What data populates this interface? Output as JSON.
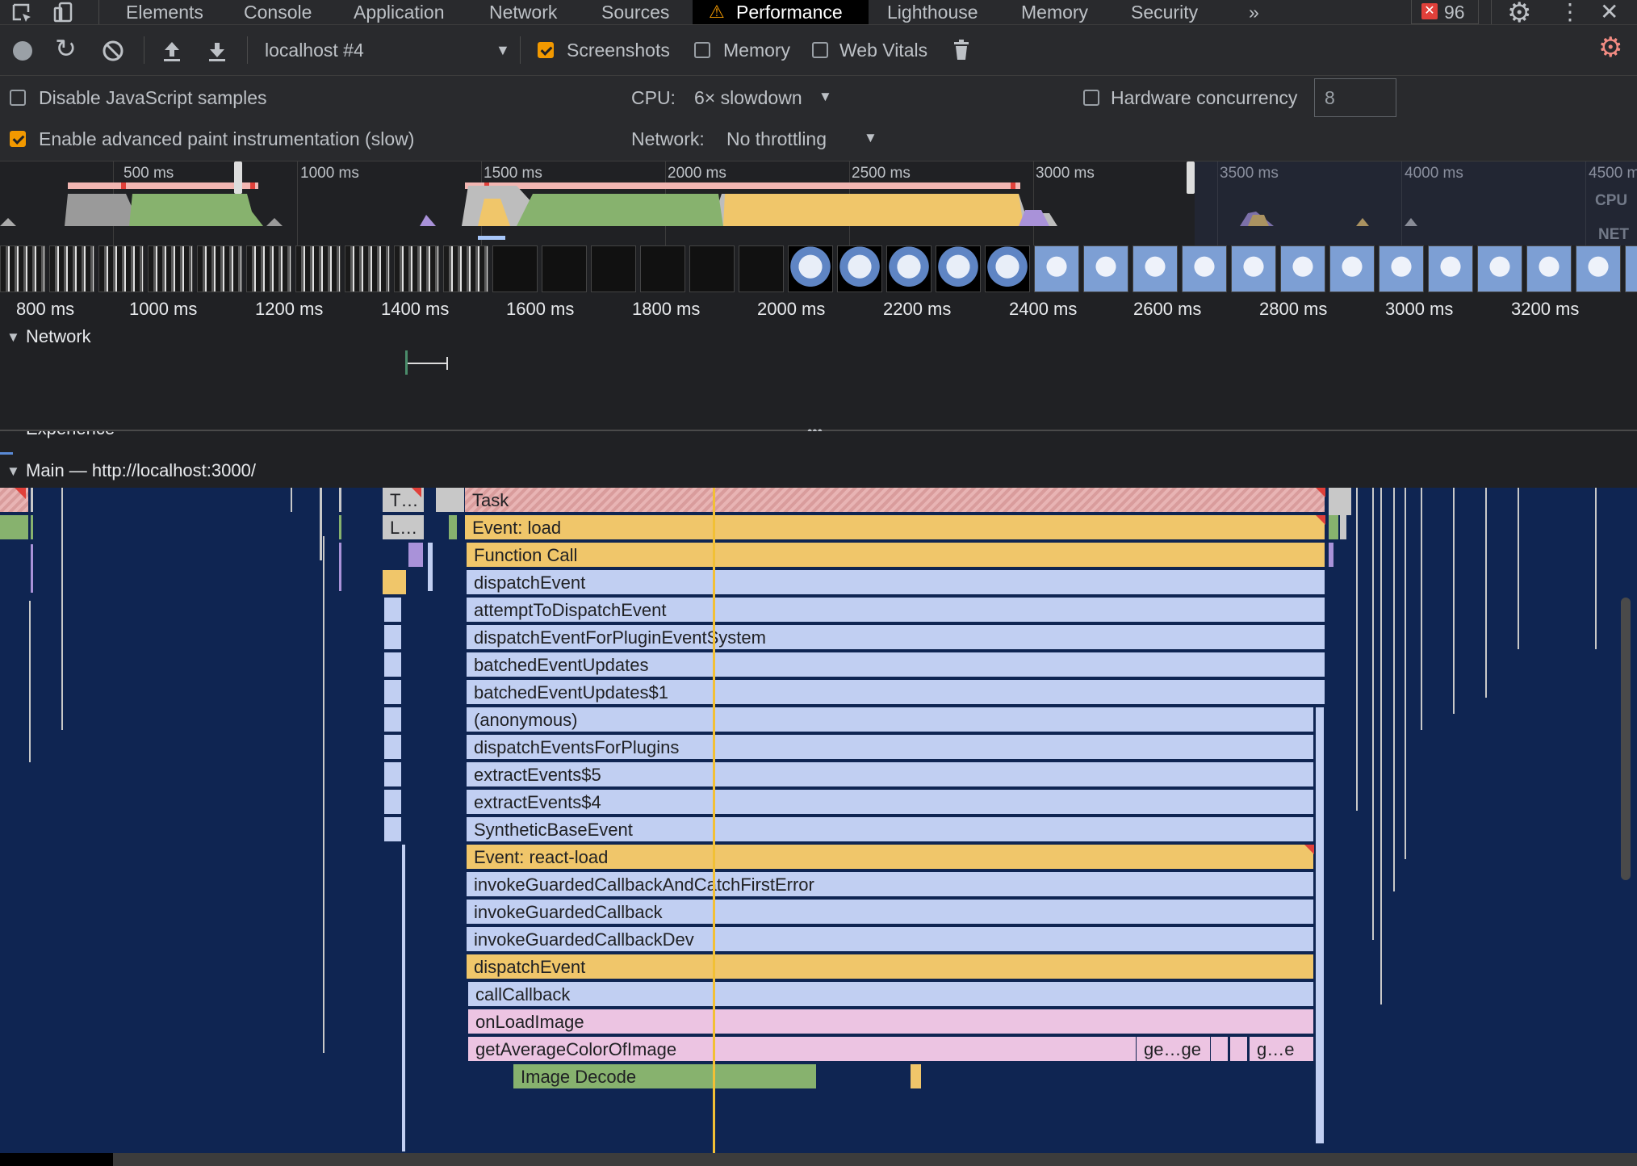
{
  "tabs": {
    "elements": "Elements",
    "console": "Console",
    "application": "Application",
    "network": "Network",
    "sources": "Sources",
    "performance": "Performance",
    "lighthouse": "Lighthouse",
    "memory": "Memory",
    "security": "Security",
    "more": "»",
    "error_count": "96"
  },
  "toolbar": {
    "profile_select": "localhost #4",
    "screenshots_label": "Screenshots",
    "screenshots_checked": true,
    "memory_label": "Memory",
    "memory_checked": false,
    "web_vitals_label": "Web Vitals",
    "web_vitals_checked": false
  },
  "settings": {
    "disable_js_samples": "Disable JavaScript samples",
    "disable_js_checked": false,
    "advanced_paint": "Enable advanced paint instrumentation (slow)",
    "advanced_paint_checked": true,
    "cpu_label": "CPU:",
    "cpu_value": "6× slowdown",
    "network_label": "Network:",
    "network_value": "No throttling",
    "hardware_concurrency": "Hardware concurrency",
    "hardware_concurrency_checked": false,
    "hardware_concurrency_value": "8"
  },
  "overview": {
    "labels": [
      "500 ms",
      "1000 ms",
      "1500 ms",
      "2000 ms",
      "2500 ms",
      "3000 ms",
      "3500 ms",
      "4000 ms",
      "4500 m"
    ],
    "cpu_label": "CPU",
    "net_label": "NET"
  },
  "ruler": {
    "labels": [
      "800 ms",
      "1000 ms",
      "1200 ms",
      "1400 ms",
      "1600 ms",
      "1800 ms",
      "2000 ms",
      "2200 ms",
      "2400 ms",
      "2600 ms",
      "2800 ms",
      "3000 ms",
      "3200 ms"
    ]
  },
  "tracks": {
    "network": "Network",
    "experience": "Experience",
    "main": "Main — http://localhost:3000/"
  },
  "flame": {
    "task_short": "T…",
    "load_short": "L…",
    "entries": [
      "Task",
      "Event: load",
      "Function Call",
      "dispatchEvent",
      "attemptToDispatchEvent",
      "dispatchEventForPluginEventSystem",
      "batchedEventUpdates",
      "batchedEventUpdates$1",
      "(anonymous)",
      "dispatchEventsForPlugins",
      "extractEvents$5",
      "extractEvents$4",
      "SyntheticBaseEvent",
      "Event: react-load",
      "invokeGuardedCallbackAndCatchFirstError",
      "invokeGuardedCallback",
      "invokeGuardedCallbackDev",
      "dispatchEvent",
      "callCallback",
      "onLoadImage",
      "getAverageColorOfImage"
    ],
    "sub_ge_1": "ge…ge",
    "sub_ge_2": "g…e",
    "image_decode": "Image Decode"
  },
  "colors": {
    "accent": "#f29900",
    "task": "#d99c9c",
    "yellow": "#f0c66a",
    "blue": "#c1cff2",
    "pink": "#ecc4e2",
    "green": "#87b26e",
    "flame_bg": "#0f2552"
  }
}
